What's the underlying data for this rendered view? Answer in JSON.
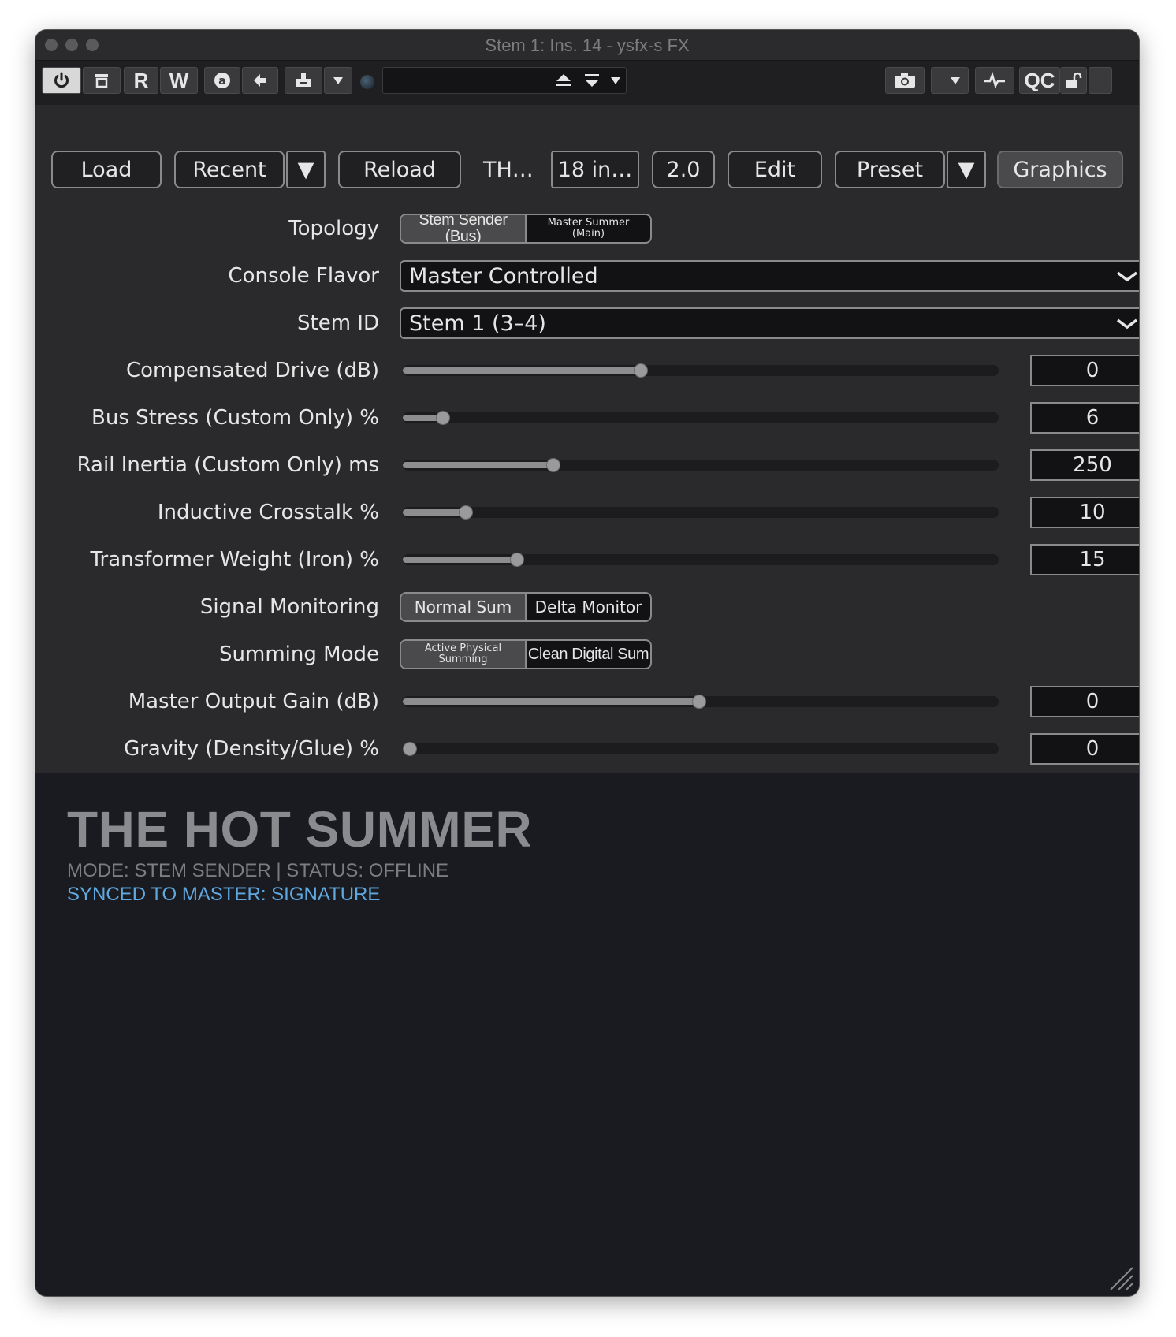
{
  "window": {
    "title": "Stem 1: Ins. 14 - ysfx-s FX"
  },
  "toolbar": {
    "r_label": "R",
    "w_label": "W",
    "qc_label": "QC",
    "icons": [
      "power-icon",
      "trash-icon",
      "a-circle-icon",
      "arrow-left-icon",
      "plugin-icon",
      "down-arrow-icon",
      "led-icon",
      "up-triangle-icon",
      "down-triangle-icon",
      "camera-icon",
      "waveform-icon",
      "lock-icon"
    ]
  },
  "header": {
    "load": "Load",
    "recent": "Recent",
    "recent_arrow": "▼",
    "reload": "Reload",
    "name_short": "TH…",
    "io": "18 in…",
    "version": "2.0",
    "edit": "Edit",
    "preset": "Preset",
    "preset_arrow": "▼",
    "graphics": "Graphics"
  },
  "params": {
    "topology": {
      "label": "Topology",
      "options": [
        "Stem Sender (Bus)",
        "Master Summer\n(Main)"
      ],
      "selected": 0
    },
    "console_flavor": {
      "label": "Console Flavor",
      "value": "Master Controlled"
    },
    "stem_id": {
      "label": "Stem ID",
      "value": "Stem 1 (3–4)"
    },
    "sliders": [
      {
        "label": "Compensated Drive (dB)",
        "value": "0",
        "fraction": 0.4
      },
      {
        "label": "Bus Stress (Custom Only) %",
        "value": "6",
        "fraction": 0.068
      },
      {
        "label": "Rail Inertia (Custom Only) ms",
        "value": "250",
        "fraction": 0.253
      },
      {
        "label": "Inductive Crosstalk %",
        "value": "10",
        "fraction": 0.106
      },
      {
        "label": "Transformer Weight (Iron) %",
        "value": "15",
        "fraction": 0.192
      }
    ],
    "signal_monitoring": {
      "label": "Signal Monitoring",
      "options": [
        "Normal Sum",
        "Delta Monitor"
      ],
      "selected": 0
    },
    "summing_mode": {
      "label": "Summing Mode",
      "options": [
        "Active Physical\nSumming",
        "Clean Digital Sum"
      ],
      "selected": 0
    },
    "sliders2": [
      {
        "label": "Master Output Gain (dB)",
        "value": "0",
        "fraction": 0.497
      },
      {
        "label": "Gravity (Density/Glue) %",
        "value": "0",
        "fraction": 0.0
      }
    ]
  },
  "display": {
    "title": "THE HOT SUMMER",
    "mode_line": "MODE: STEM SENDER | STATUS: OFFLINE",
    "sync_line": "SYNCED TO MASTER: SIGNATURE",
    "sync_color": "#5fa8e0"
  }
}
